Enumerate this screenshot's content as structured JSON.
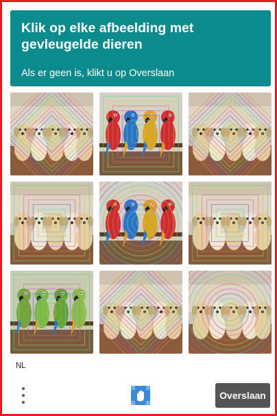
{
  "header": {
    "title": "Klik op elke afbeelding met gevleugelde dieren",
    "subtitle": "Als er geen is, klikt u op Overslaan"
  },
  "grid": {
    "tiles": [
      {
        "subject": "puppies",
        "pattern": "diamonds"
      },
      {
        "subject": "parrots",
        "pattern": "squares"
      },
      {
        "subject": "puppies",
        "pattern": "diamonds"
      },
      {
        "subject": "puppies",
        "pattern": "squares"
      },
      {
        "subject": "parrots",
        "pattern": "circles"
      },
      {
        "subject": "puppies",
        "pattern": "squares"
      },
      {
        "subject": "parrots",
        "pattern": "squares"
      },
      {
        "subject": "puppies",
        "pattern": "diamonds"
      },
      {
        "subject": "puppies",
        "pattern": "circles"
      }
    ]
  },
  "footer": {
    "language": "NL",
    "skip_label": "Overslaan",
    "menu_icon": "more-vertical-icon",
    "logo_icon": "hand-logo-icon"
  },
  "colors": {
    "header_bg": "#0c8a8c",
    "frame_border": "#e31b1b",
    "skip_bg": "#555555"
  }
}
